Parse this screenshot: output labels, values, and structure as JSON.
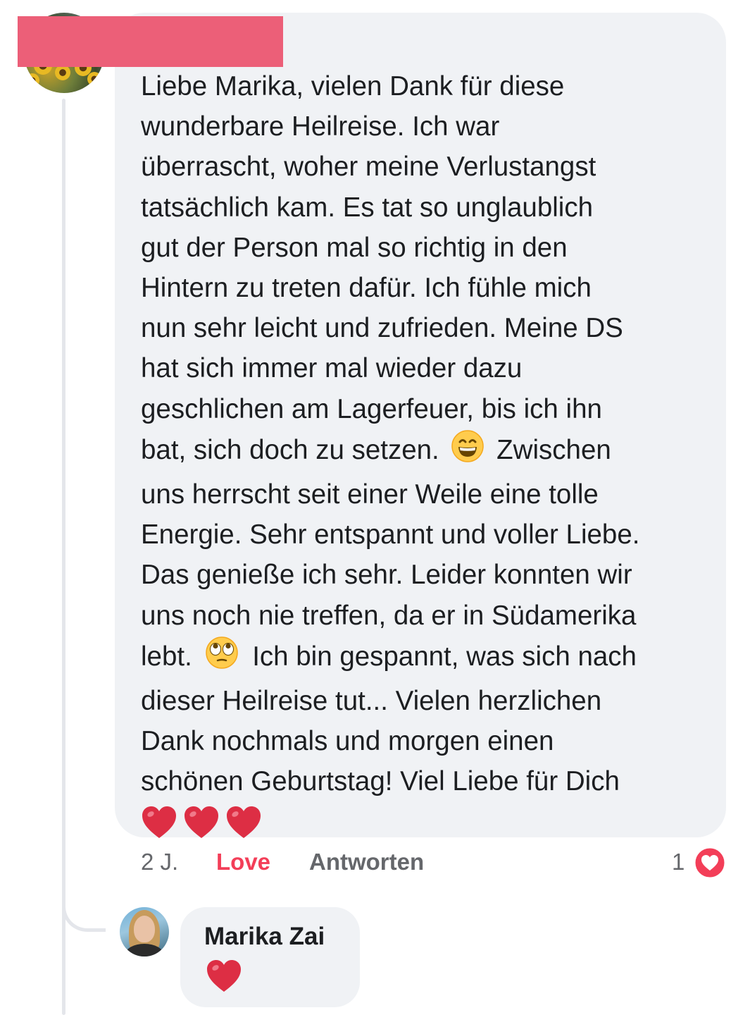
{
  "comment": {
    "author_redacted": true,
    "text_lines": [
      "Liebe Marika, vielen Dank für diese",
      "wunderbare Heilreise. Ich war",
      "überrascht, woher meine Verlustangst",
      "tatsächlich kam. Es tat so unglaublich",
      "gut der Person mal so richtig in den",
      "Hintern zu treten dafür. Ich fühle mich",
      "nun sehr leicht und zufrieden. Meine DS",
      "hat sich immer mal wieder dazu",
      "geschlichen am Lagerfeuer, bis ich ihn"
    ],
    "line_10_before_emoji": "bat, sich doch zu setzen.",
    "line_10_after_emoji": "Zwischen",
    "emoji_grin": "grinning-face-icon",
    "text_lines_b": [
      "uns herrscht seit einer Weile eine tolle",
      "Energie. Sehr entspannt und voller Liebe.",
      "Das genieße ich sehr. Leider konnten wir",
      "uns noch nie treffen, da er in Südamerika"
    ],
    "line_15_before_emoji": "lebt.",
    "line_15_after_emoji": "Ich bin gespannt, was sich nach",
    "emoji_eyeroll": "eye-roll-face-icon",
    "text_lines_c": [
      "dieser Heilreise tut... Vielen herzlichen",
      "Dank nochmals und morgen einen",
      "schönen Geburtstag! Viel Liebe für Dich"
    ],
    "hearts": [
      "red-heart-icon",
      "red-heart-icon",
      "red-heart-icon"
    ]
  },
  "actions": {
    "time": "2 J.",
    "love_label": "Love",
    "reply_label": "Antworten",
    "reaction_count": "1",
    "reaction_icon": "love-reaction-icon"
  },
  "reply": {
    "author": "Marika Zai",
    "content_icon": "red-heart-icon"
  },
  "colors": {
    "bubble": "#f0f2f5",
    "love_accent": "#f33e58",
    "secondary_text": "#65676b",
    "redaction": "#ec5f78",
    "thread_line": "#e4e6eb"
  }
}
